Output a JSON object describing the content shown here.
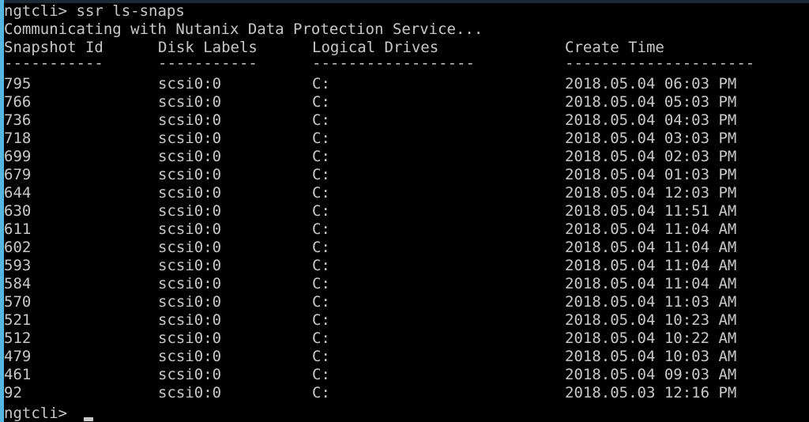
{
  "terminal": {
    "shell_name": "ngtcli",
    "prompt": "ngtcli>",
    "command_line": "ngtcli> ssr ls-snaps",
    "command": "ssr ls-snaps",
    "status_message": "Communicating with Nutanix Data Protection Service...",
    "trailing_prompt": "ngtcli>",
    "cursor_glyph": "_",
    "colors": {
      "background": "#000000",
      "foreground": "#c8c8c8",
      "left_border": "#57b6e0",
      "top_border": "#1c2a38"
    }
  },
  "table": {
    "columns": [
      {
        "header": "Snapshot Id",
        "rule": "-----------"
      },
      {
        "header": "Disk Labels",
        "rule": "-----------"
      },
      {
        "header": "Logical Drives",
        "rule": "------------------"
      },
      {
        "header": "Create Time",
        "rule": "---------------------"
      }
    ],
    "rows": [
      {
        "snapshot_id": "795",
        "disk_label": "scsi0:0",
        "logical_drive": "C:",
        "create_time": "2018.05.04 06:03 PM"
      },
      {
        "snapshot_id": "766",
        "disk_label": "scsi0:0",
        "logical_drive": "C:",
        "create_time": "2018.05.04 05:03 PM"
      },
      {
        "snapshot_id": "736",
        "disk_label": "scsi0:0",
        "logical_drive": "C:",
        "create_time": "2018.05.04 04:03 PM"
      },
      {
        "snapshot_id": "718",
        "disk_label": "scsi0:0",
        "logical_drive": "C:",
        "create_time": "2018.05.04 03:03 PM"
      },
      {
        "snapshot_id": "699",
        "disk_label": "scsi0:0",
        "logical_drive": "C:",
        "create_time": "2018.05.04 02:03 PM"
      },
      {
        "snapshot_id": "679",
        "disk_label": "scsi0:0",
        "logical_drive": "C:",
        "create_time": "2018.05.04 01:03 PM"
      },
      {
        "snapshot_id": "644",
        "disk_label": "scsi0:0",
        "logical_drive": "C:",
        "create_time": "2018.05.04 12:03 PM"
      },
      {
        "snapshot_id": "630",
        "disk_label": "scsi0:0",
        "logical_drive": "C:",
        "create_time": "2018.05.04 11:51 AM"
      },
      {
        "snapshot_id": "611",
        "disk_label": "scsi0:0",
        "logical_drive": "C:",
        "create_time": "2018.05.04 11:04 AM"
      },
      {
        "snapshot_id": "602",
        "disk_label": "scsi0:0",
        "logical_drive": "C:",
        "create_time": "2018.05.04 11:04 AM"
      },
      {
        "snapshot_id": "593",
        "disk_label": "scsi0:0",
        "logical_drive": "C:",
        "create_time": "2018.05.04 11:04 AM"
      },
      {
        "snapshot_id": "584",
        "disk_label": "scsi0:0",
        "logical_drive": "C:",
        "create_time": "2018.05.04 11:04 AM"
      },
      {
        "snapshot_id": "570",
        "disk_label": "scsi0:0",
        "logical_drive": "C:",
        "create_time": "2018.05.04 11:03 AM"
      },
      {
        "snapshot_id": "521",
        "disk_label": "scsi0:0",
        "logical_drive": "C:",
        "create_time": "2018.05.04 10:23 AM"
      },
      {
        "snapshot_id": "512",
        "disk_label": "scsi0:0",
        "logical_drive": "C:",
        "create_time": "2018.05.04 10:22 AM"
      },
      {
        "snapshot_id": "479",
        "disk_label": "scsi0:0",
        "logical_drive": "C:",
        "create_time": "2018.05.04 10:03 AM"
      },
      {
        "snapshot_id": "461",
        "disk_label": "scsi0:0",
        "logical_drive": "C:",
        "create_time": "2018.05.04 09:03 AM"
      },
      {
        "snapshot_id": "92",
        "disk_label": "scsi0:0",
        "logical_drive": "C:",
        "create_time": "2018.05.03 12:16 PM"
      }
    ]
  }
}
